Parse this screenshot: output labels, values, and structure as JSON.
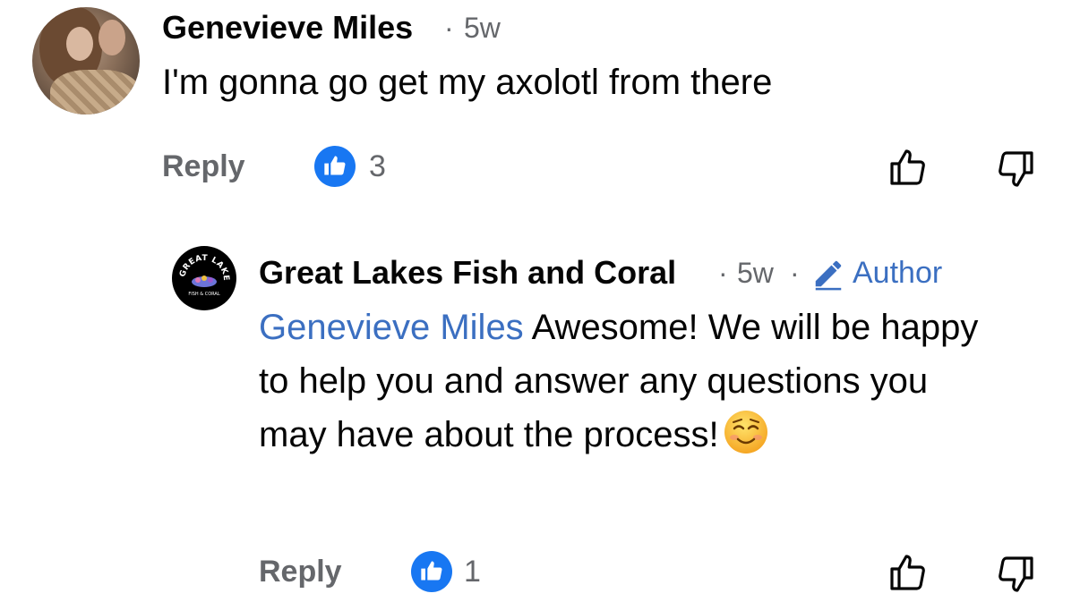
{
  "comment": {
    "author": "Genevieve Miles",
    "separator": "·",
    "time": "5w",
    "text": "I'm gonna go get my axolotl from there",
    "reply_label": "Reply",
    "like_count": "3"
  },
  "reply": {
    "author": "Great Lakes Fish and Coral",
    "separator": "·",
    "time": "5w",
    "separator2": "·",
    "badge_label": "Author",
    "mention": "Genevieve Miles",
    "text": " Awesome!  We will be happy to help you and answer any questions you may have about the process!",
    "emoji": "smiling-face-icon",
    "reply_label": "Reply",
    "like_count": "1",
    "logo_text_top": "GREAT LAKES",
    "logo_text_bottom": "FISH & CORAL"
  },
  "colors": {
    "like_blue": "#1877f2",
    "mention_blue": "#3b6fc1",
    "secondary_gray": "#65676b"
  }
}
